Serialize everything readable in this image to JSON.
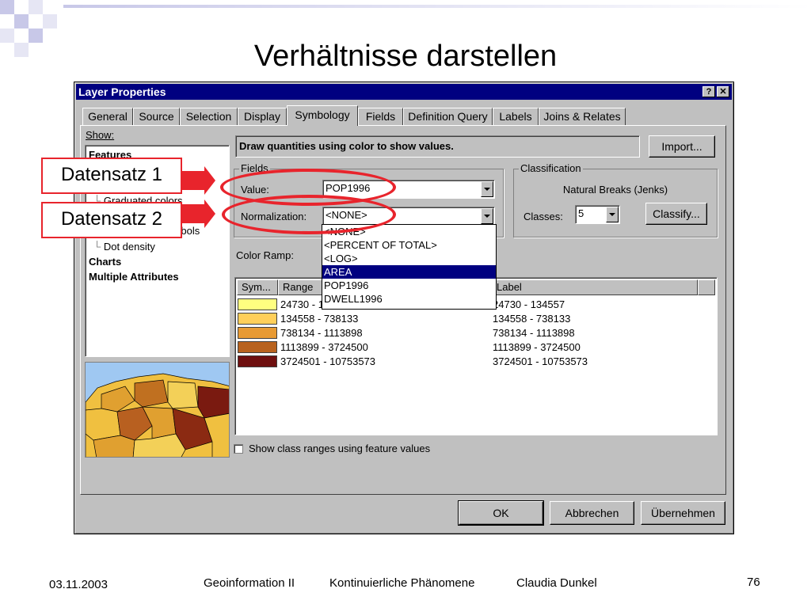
{
  "slide": {
    "title": "Verhältnisse darstellen",
    "footer_date": "03.11.2003",
    "footer_course": "Geoinformation II",
    "footer_topic": "Kontinuierliche Phänomene",
    "footer_author": "Claudia Dunkel",
    "page_number": "76",
    "callout_1": "Datensatz 1",
    "callout_2": "Datensatz 2",
    "colors": {
      "accent_red": "#e8242c",
      "deco_dark": "#c8c8e8",
      "deco_light": "#e6e6f4"
    }
  },
  "dialog": {
    "title": "Layer Properties",
    "help_icon": "?",
    "close_icon": "✕",
    "tabs": [
      "General",
      "Source",
      "Selection",
      "Display",
      "Symbology",
      "Fields",
      "Definition Query",
      "Labels",
      "Joins & Relates"
    ],
    "active_tab": "Symbology",
    "show_label": "Show:",
    "show_tree": {
      "features": "Features",
      "graduated_colors": "Graduated colors",
      "proportional_symbols": "Proportional symbols",
      "dot_density": "Dot density",
      "charts": "Charts",
      "multiple_attributes": "Multiple Attributes"
    },
    "description": "Draw quantities using color to show values.",
    "import_button": "Import...",
    "fields": {
      "group_label": "Fields",
      "value_label": "Value:",
      "value": "POP1996",
      "normalization_label": "Normalization:",
      "normalization": "<NONE>"
    },
    "classification": {
      "group_label": "Classification",
      "method": "Natural Breaks (Jenks)",
      "classes_label": "Classes:",
      "classes": "5",
      "classify_button": "Classify..."
    },
    "color_ramp_label": "Color Ramp:",
    "dropdown_options": [
      "<NONE>",
      "<PERCENT OF TOTAL>",
      "<LOG>",
      "AREA",
      "POP1996",
      "DWELL1996"
    ],
    "dropdown_selected": "AREA",
    "table": {
      "headers": [
        "Sym...",
        "Range",
        "Label"
      ],
      "rows": [
        {
          "color": "#ffff80",
          "range": "24730 - 134557",
          "label": "24730 - 134557"
        },
        {
          "color": "#ffcf5a",
          "range": "134558 - 738133",
          "label": "134558 - 738133"
        },
        {
          "color": "#e89a33",
          "range": "738134 - 1113898",
          "label": "738134 - 1113898"
        },
        {
          "color": "#b8621e",
          "range": "1113899 - 3724500",
          "label": "1113899 - 3724500"
        },
        {
          "color": "#6e0f0f",
          "range": "3724501 - 10753573",
          "label": "3724501 - 10753573"
        }
      ]
    },
    "show_ranges_checkbox": "Show class ranges using feature values",
    "buttons": {
      "ok": "OK",
      "cancel": "Abbrechen",
      "apply": "Übernehmen"
    }
  }
}
